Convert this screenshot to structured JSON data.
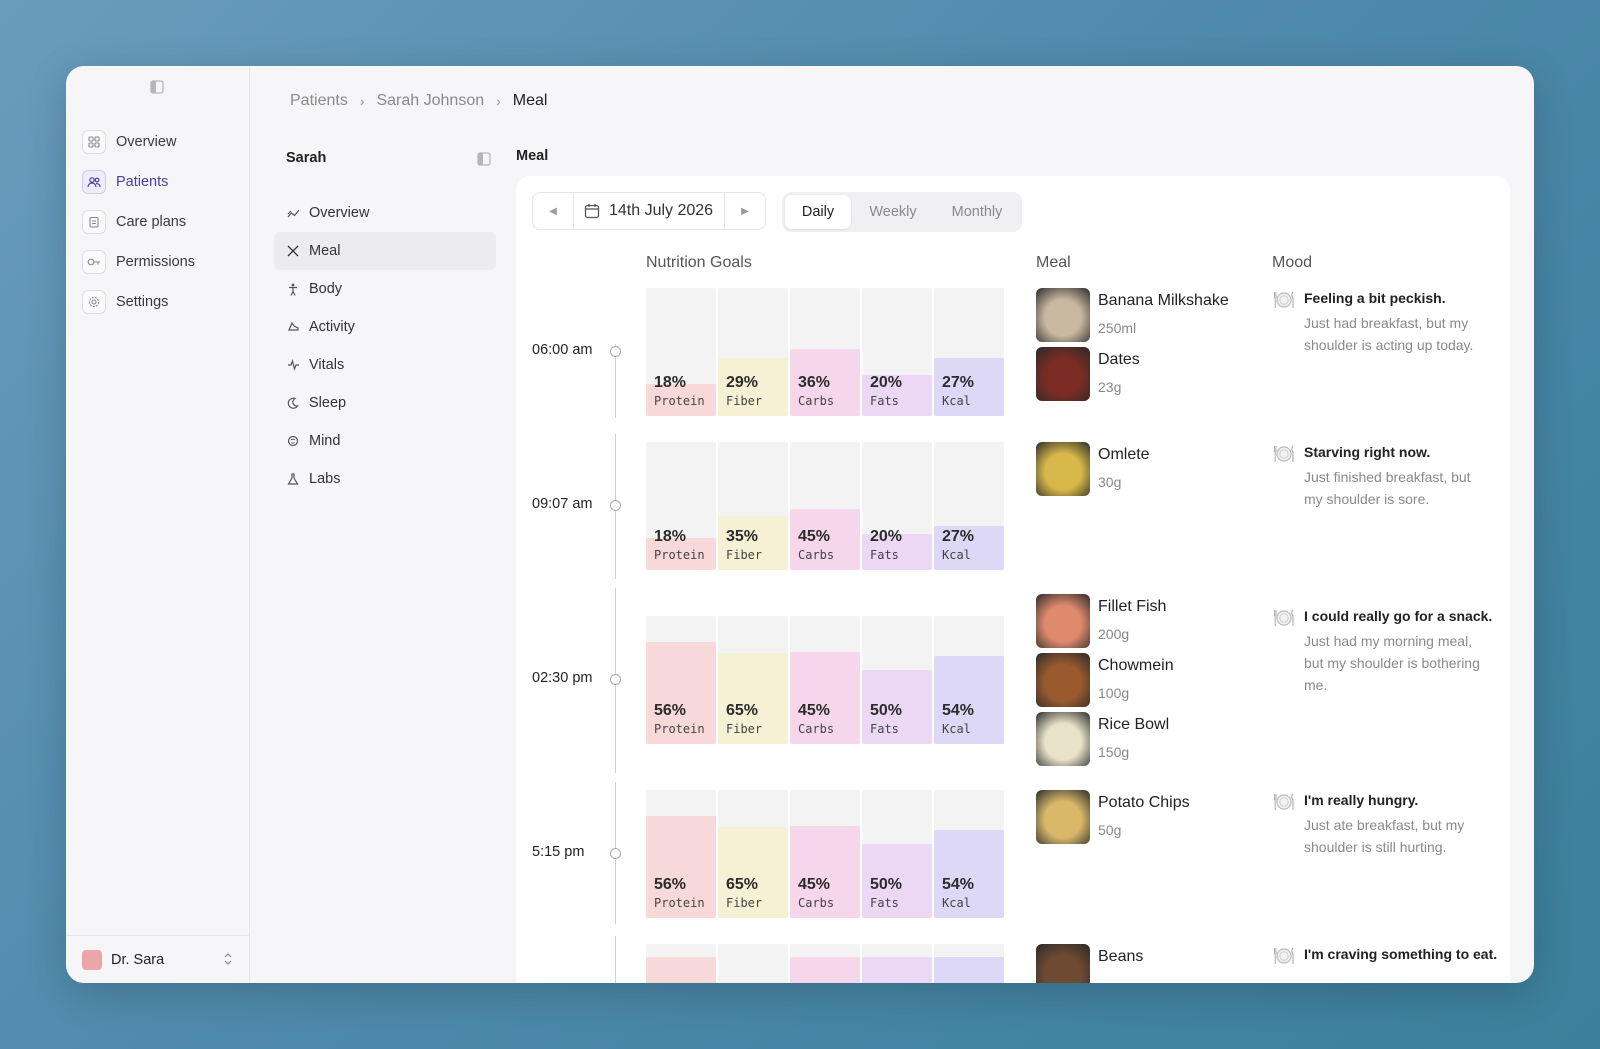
{
  "sidebar": {
    "items": [
      {
        "label": "Overview",
        "icon": "grid-icon",
        "active": false
      },
      {
        "label": "Patients",
        "icon": "users-icon",
        "active": true
      },
      {
        "label": "Care plans",
        "icon": "clipboard-icon",
        "active": false
      },
      {
        "label": "Permissions",
        "icon": "key-icon",
        "active": false
      },
      {
        "label": "Settings",
        "icon": "gear-icon",
        "active": false
      }
    ],
    "user": {
      "name": "Dr. Sara",
      "avatar_color": "#eaa7a7"
    }
  },
  "breadcrumb": [
    "Patients",
    "Sarah Johnson",
    "Meal"
  ],
  "subnav": {
    "title": "Sarah",
    "items": [
      {
        "label": "Overview",
        "icon": "trend-icon"
      },
      {
        "label": "Meal",
        "icon": "utensils-icon",
        "active": true
      },
      {
        "label": "Body",
        "icon": "body-icon"
      },
      {
        "label": "Activity",
        "icon": "shoe-icon"
      },
      {
        "label": "Vitals",
        "icon": "pulse-icon"
      },
      {
        "label": "Sleep",
        "icon": "moon-icon"
      },
      {
        "label": "Mind",
        "icon": "brain-icon"
      },
      {
        "label": "Labs",
        "icon": "flask-icon"
      }
    ]
  },
  "main": {
    "title": "Meal",
    "date": "14th July 2026",
    "tabs": [
      "Daily",
      "Weekly",
      "Monthly"
    ],
    "active_tab": "Daily",
    "columns": {
      "nutrition": "Nutrition Goals",
      "meal": "Meal",
      "mood": "Mood"
    },
    "nutrient_colors": {
      "Protein": "#f7d9d9",
      "Fiber": "#f6f0d4",
      "Carbs": "#f6d6ea",
      "Fats": "#ecd8f5",
      "Kcal": "#dcd8f6"
    },
    "rows": [
      {
        "time": "06:00 am",
        "nutrients": [
          {
            "value": "18%",
            "label": "Protein",
            "level": 0.25
          },
          {
            "value": "29%",
            "label": "Fiber",
            "level": 0.45
          },
          {
            "value": "36%",
            "label": "Carbs",
            "level": 0.52
          },
          {
            "value": "20%",
            "label": "Fats",
            "level": 0.32
          },
          {
            "value": "27%",
            "label": "Kcal",
            "level": 0.45
          }
        ],
        "meals": [
          {
            "name": "Banana Milkshake",
            "qty": "250ml",
            "thumb": "#c9b8a0"
          },
          {
            "name": "Dates",
            "qty": "23g",
            "thumb": "#7a2c24"
          }
        ],
        "mood": {
          "title": "Feeling a bit peckish.",
          "text": "Just had breakfast, but my shoulder is acting up today."
        }
      },
      {
        "time": "09:07 am",
        "nutrients": [
          {
            "value": "18%",
            "label": "Protein",
            "level": 0.25
          },
          {
            "value": "35%",
            "label": "Fiber",
            "level": 0.42
          },
          {
            "value": "45%",
            "label": "Carbs",
            "level": 0.48
          },
          {
            "value": "20%",
            "label": "Fats",
            "level": 0.28
          },
          {
            "value": "27%",
            "label": "Kcal",
            "level": 0.34
          }
        ],
        "meals": [
          {
            "name": "Omlete",
            "qty": "30g",
            "thumb": "#d8b84a"
          }
        ],
        "mood": {
          "title": "Starving right now.",
          "text": "Just finished breakfast, but my shoulder is sore."
        }
      },
      {
        "time": "02:30 pm",
        "nutrients": [
          {
            "value": "56%",
            "label": "Protein",
            "level": 0.8
          },
          {
            "value": "65%",
            "label": "Fiber",
            "level": 0.71
          },
          {
            "value": "45%",
            "label": "Carbs",
            "level": 0.72
          },
          {
            "value": "50%",
            "label": "Fats",
            "level": 0.58
          },
          {
            "value": "54%",
            "label": "Kcal",
            "level": 0.69
          }
        ],
        "meals": [
          {
            "name": "Fillet Fish",
            "qty": "200g",
            "thumb": "#e08a6c"
          },
          {
            "name": "Chowmein",
            "qty": "100g",
            "thumb": "#9a5a2e"
          },
          {
            "name": "Rice Bowl",
            "qty": "150g",
            "thumb": "#e8e2c8"
          }
        ],
        "mood": {
          "title": "I could really go for a snack.",
          "text": "Just had my morning meal, but my shoulder is bothering me."
        }
      },
      {
        "time": "5:15 pm",
        "nutrients": [
          {
            "value": "56%",
            "label": "Protein",
            "level": 0.8
          },
          {
            "value": "65%",
            "label": "Fiber",
            "level": 0.71
          },
          {
            "value": "45%",
            "label": "Carbs",
            "level": 0.72
          },
          {
            "value": "50%",
            "label": "Fats",
            "level": 0.58
          },
          {
            "value": "54%",
            "label": "Kcal",
            "level": 0.69
          }
        ],
        "meals": [
          {
            "name": "Potato Chips",
            "qty": "50g",
            "thumb": "#d9b86a"
          }
        ],
        "mood": {
          "title": "I'm really hungry.",
          "text": "Just ate breakfast, but my shoulder is still hurting."
        }
      },
      {
        "time": "",
        "nutrients": [
          {
            "value": "",
            "label": "",
            "level": 0.9
          },
          {
            "value": "",
            "label": "",
            "level": 0.7
          },
          {
            "value": "",
            "label": "",
            "level": 0.9
          },
          {
            "value": "",
            "label": "",
            "level": 0.9
          },
          {
            "value": "",
            "label": "",
            "level": 0.9
          }
        ],
        "meals": [
          {
            "name": "Beans",
            "qty": "",
            "thumb": "#6e4a32"
          }
        ],
        "mood": {
          "title": "I'm craving something to eat.",
          "text": ""
        }
      }
    ]
  }
}
